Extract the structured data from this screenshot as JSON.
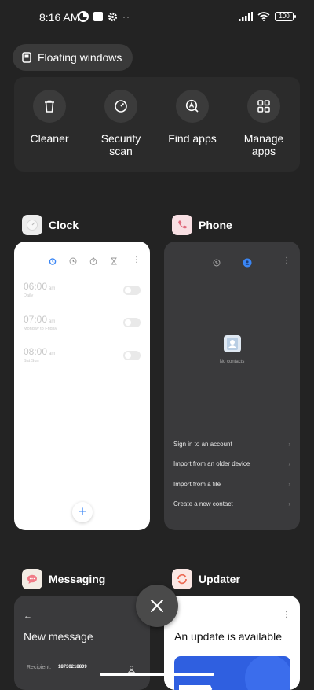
{
  "status_bar": {
    "time": "8:16 AM",
    "battery": "100"
  },
  "floating_windows": {
    "label": "Floating windows"
  },
  "quick_actions": [
    {
      "label": "Cleaner",
      "icon": "trash-icon"
    },
    {
      "label": "Security scan",
      "icon": "security-scan-icon"
    },
    {
      "label": "Find apps",
      "icon": "find-apps-icon"
    },
    {
      "label": "Manage apps",
      "icon": "manage-apps-icon"
    }
  ],
  "apps": {
    "clock": {
      "name": "Clock",
      "alarms": [
        {
          "time": "06:00",
          "period": "am",
          "sub": "Daily"
        },
        {
          "time": "07:00",
          "period": "am",
          "sub": "Monday to Friday"
        },
        {
          "time": "08:00",
          "period": "am",
          "sub": "Sat Sun"
        }
      ],
      "fab": "+"
    },
    "phone": {
      "name": "Phone",
      "empty_text": "No contacts",
      "options": [
        "Sign in to an account",
        "Import from an older device",
        "Import from a file",
        "Create a new contact"
      ]
    },
    "messaging": {
      "name": "Messaging",
      "title": "New message",
      "recipient_label": "Recipient:",
      "recipient_value": "18730218809"
    },
    "updater": {
      "name": "Updater",
      "title": "An update is available"
    }
  },
  "colors": {
    "background": "#232323",
    "panel": "#2b2b2b",
    "accent_blue": "#3a86f5"
  }
}
